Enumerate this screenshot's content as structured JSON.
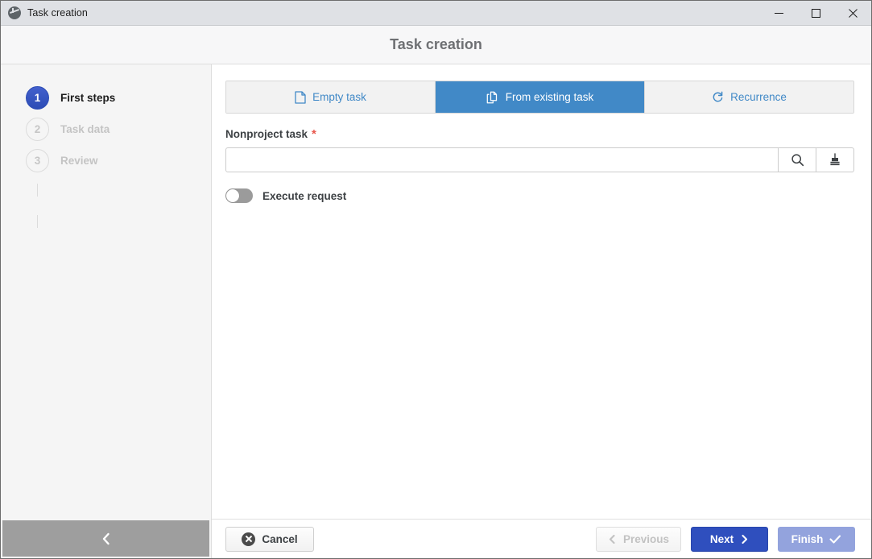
{
  "window": {
    "title": "Task creation",
    "icon": "globe-icon",
    "controls": {
      "minimize": "minimize-icon",
      "maximize": "maximize-icon",
      "close": "close-icon"
    }
  },
  "header": {
    "title": "Task creation"
  },
  "sidebar": {
    "steps": [
      {
        "number": "1",
        "label": "First steps",
        "state": "active"
      },
      {
        "number": "2",
        "label": "Task data",
        "state": "inactive"
      },
      {
        "number": "3",
        "label": "Review",
        "state": "inactive"
      }
    ],
    "collapse": {
      "icon": "chevron-left-icon",
      "label": ""
    }
  },
  "main": {
    "tabs": [
      {
        "label": "Empty task",
        "icon": "document-icon",
        "selected": false
      },
      {
        "label": "From existing task",
        "icon": "copy-document-icon",
        "selected": true
      },
      {
        "label": "Recurrence",
        "icon": "recurrence-icon",
        "selected": false
      }
    ],
    "field": {
      "label": "Nonproject task",
      "required_marker": "*",
      "value": "",
      "placeholder": "",
      "search_button": "search-icon",
      "clear_button": "clear-brush-icon"
    },
    "toggle": {
      "label": "Execute request",
      "state": "off"
    }
  },
  "footer": {
    "cancel": "Cancel",
    "previous": "Previous",
    "next": "Next",
    "finish": "Finish"
  },
  "colors": {
    "tab_selected": "#4189c7",
    "tab_text": "#4189c7",
    "step_active": "#2f4fb8",
    "next_button": "#2f4fbe",
    "finish_button": "#93a3dd",
    "required_asterisk": "#e8574c",
    "titlebar": "#dfe1e5",
    "collapse_bar": "#9e9e9e"
  }
}
